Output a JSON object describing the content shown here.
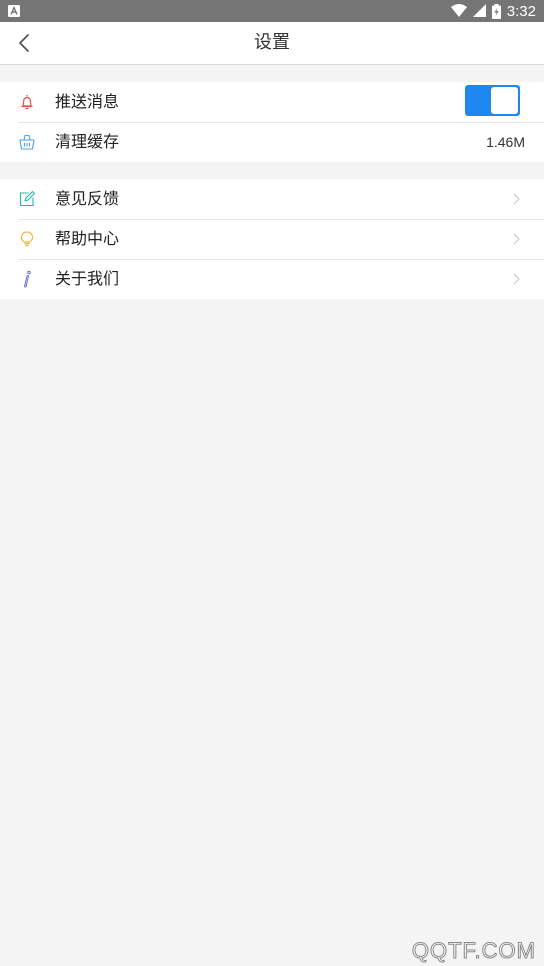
{
  "status_bar": {
    "time": "3:32"
  },
  "header": {
    "title": "设置"
  },
  "group1": {
    "items": [
      {
        "label": "推送消息",
        "icon": "bell-icon",
        "toggle_on": true
      },
      {
        "label": "清理缓存",
        "icon": "basket-icon",
        "value": "1.46M"
      }
    ]
  },
  "group2": {
    "items": [
      {
        "label": "意见反馈",
        "icon": "edit-icon"
      },
      {
        "label": "帮助中心",
        "icon": "lightbulb-icon"
      },
      {
        "label": "关于我们",
        "icon": "info-icon"
      }
    ]
  },
  "colors": {
    "accent": "#1e88f0",
    "bell": "#e0504a",
    "basket": "#4f9fe0",
    "edit": "#27b8a8",
    "bulb": "#f5b640",
    "info": "#6a6adf"
  },
  "watermark": "QQTF.COM"
}
